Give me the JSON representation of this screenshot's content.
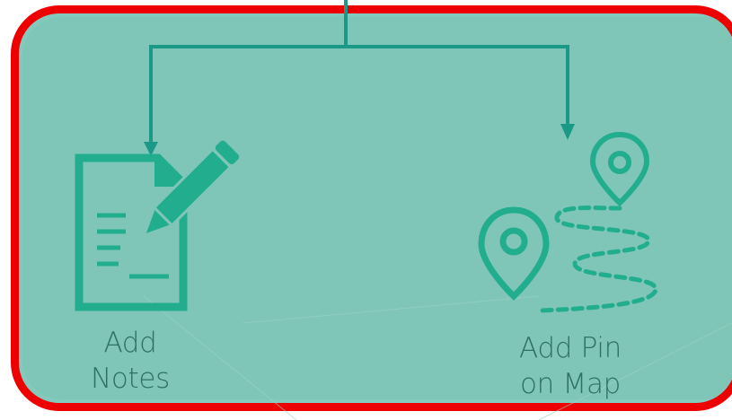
{
  "colors": {
    "frame_border": "#ee0000",
    "panel_fill": "#83c9bc",
    "connector": "#1a9a86",
    "icon": "#22ae8e",
    "label_text": "#2f6f66"
  },
  "nodes": {
    "notes": {
      "icon": "notes-edit-icon",
      "label_line1": "Add",
      "label_line2": "Notes"
    },
    "pin": {
      "icon": "map-pin-route-icon",
      "label_line1": "Add Pin",
      "label_line2": "on Map"
    }
  }
}
